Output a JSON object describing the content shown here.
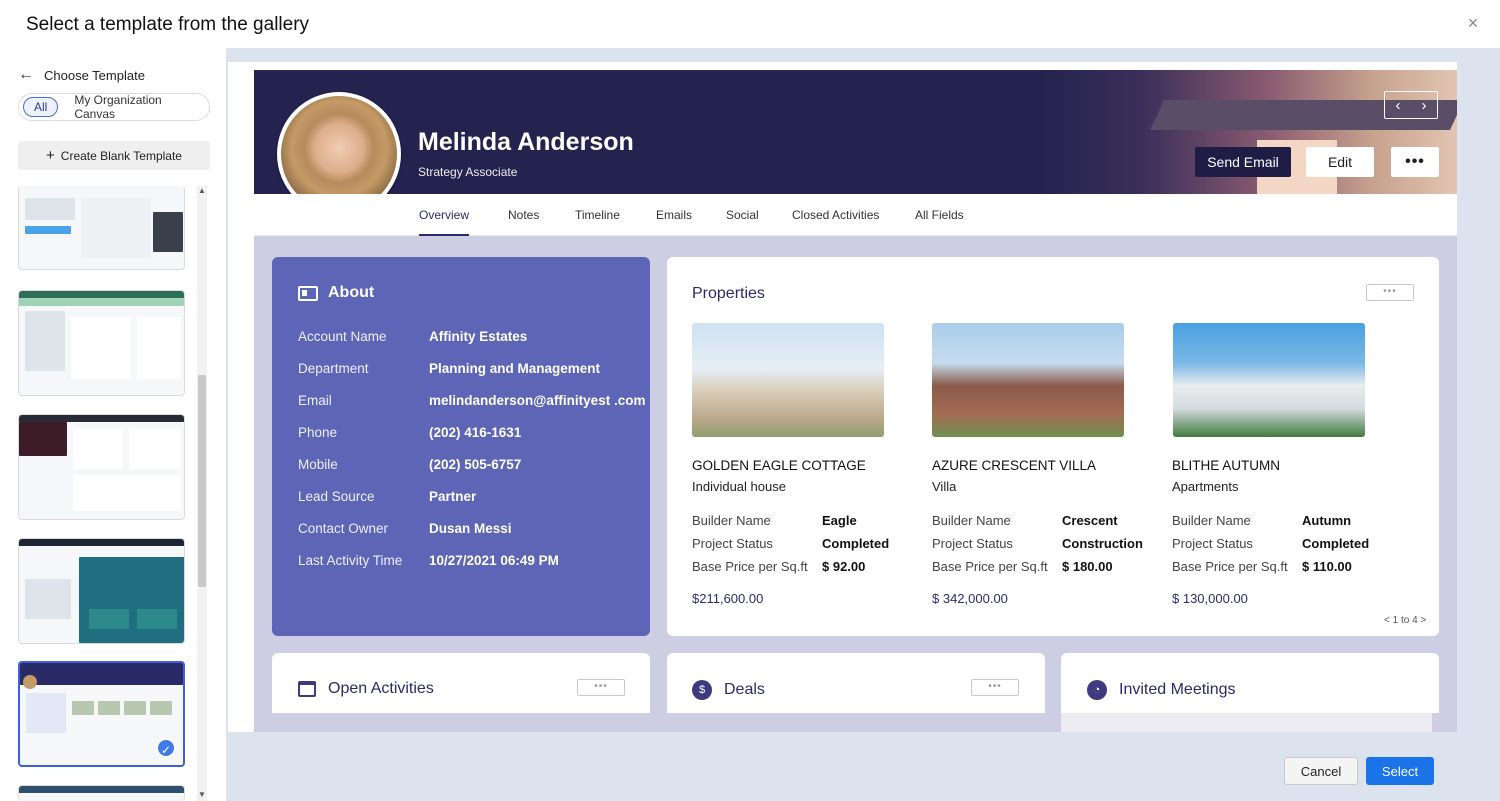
{
  "dialog": {
    "title": "Select a template from the gallery",
    "close_label": "×"
  },
  "sidebar": {
    "back_label": "Choose Template",
    "filters": [
      {
        "label": "All",
        "active": true
      },
      {
        "label": "My Organization Canvas",
        "active": false
      }
    ],
    "create_blank_label": "Create Blank Template",
    "selected_check": "✓"
  },
  "preview": {
    "name": "Melinda Anderson",
    "role": "Strategy Associate",
    "actions": {
      "send_email": "Send Email",
      "edit": "Edit",
      "more": "•••",
      "prev": "‹",
      "next": "›"
    },
    "tabs": [
      "Overview",
      "Notes",
      "Timeline",
      "Emails",
      "Social",
      "Closed Activities",
      "All Fields"
    ],
    "about": {
      "title": "About",
      "rows": [
        {
          "k": "Account Name",
          "v": "Affinity Estates"
        },
        {
          "k": "Department",
          "v": "Planning and Management"
        },
        {
          "k": "Email",
          "v": "melindanderson@affinityest .com"
        },
        {
          "k": "Phone",
          "v": "(202) 416-1631"
        },
        {
          "k": "Mobile",
          "v": "(202) 505-6757"
        },
        {
          "k": "Lead Source",
          "v": "Partner"
        },
        {
          "k": "Contact Owner",
          "v": "Dusan Messi"
        },
        {
          "k": "Last Activity Time",
          "v": "10/27/2021 06:49 PM"
        }
      ]
    },
    "properties": {
      "title": "Properties",
      "more": "•••",
      "pager": "< 1 to 4 >",
      "labels": {
        "builder": "Builder Name",
        "status": "Project Status",
        "price": "Base Price per Sq.ft"
      },
      "items": [
        {
          "name": "GOLDEN EAGLE COTTAGE",
          "type": "Individual house",
          "builder": "Eagle",
          "status": "Completed",
          "price": "$ 92.00",
          "total": "$211,600.00"
        },
        {
          "name": "AZURE CRESCENT VILLA",
          "type": "Villa",
          "builder": "Crescent",
          "status": "Construction",
          "price": "$ 180.00",
          "total": "$ 342,000.00"
        },
        {
          "name": "BLITHE AUTUMN",
          "type": "Apartments",
          "builder": "Autumn",
          "status": "Completed",
          "price": "$ 110.00",
          "total": "$ 130,000.00"
        }
      ]
    },
    "bottom": {
      "open_activities": "Open Activities",
      "deals": "Deals",
      "deals_icon": "$",
      "invited_meetings": "Invited Meetings",
      "more": "•••"
    }
  },
  "footer": {
    "cancel": "Cancel",
    "select": "Select"
  }
}
